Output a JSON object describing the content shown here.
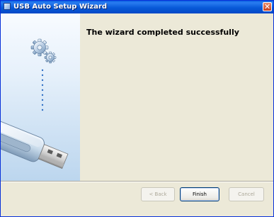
{
  "window": {
    "title": "USB Auto Setup Wizard",
    "close_symbol": "✕"
  },
  "main": {
    "heading": "The wizard completed successfully"
  },
  "buttons": {
    "back_label": "< Back",
    "finish_label": "Finish",
    "cancel_label": "Cancel"
  },
  "icons": {
    "title": "usb-wizard-icon",
    "gears": "gears-icon",
    "usb_drive": "usb-drive-icon"
  },
  "colors": {
    "titlebar": "#0a5fe0",
    "sidepanel": "#dbe9f7",
    "dialog_bg": "#ece9d8",
    "focus_border": "#003c74"
  }
}
